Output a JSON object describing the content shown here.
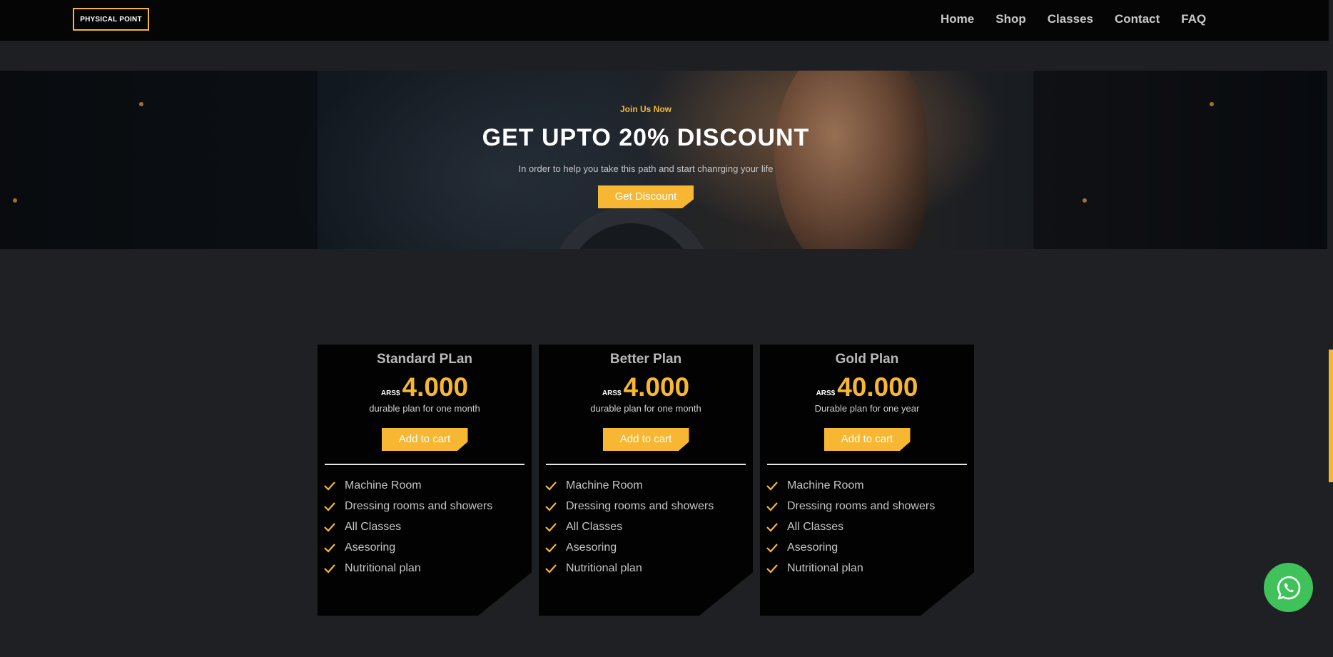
{
  "brand": {
    "logo_text": "PHYSICAL POINT",
    "accent_color": "#f7b733"
  },
  "nav": {
    "links": [
      "Home",
      "Shop",
      "Classes",
      "Contact",
      "FAQ"
    ]
  },
  "hero": {
    "eyebrow": "Join Us Now",
    "title": "GET UPTO 20% DISCOUNT",
    "subtitle": "In order to help you take this path and start chanrging your life",
    "button_label": "Get Discount"
  },
  "plans": [
    {
      "name": "Standard PLan",
      "currency": "ARS$",
      "amount": "4.000",
      "description": "durable plan for one month",
      "button_label": "Add to cart",
      "features": [
        "Machine Room",
        "Dressing rooms and showers",
        "All Classes",
        "Asesoring",
        "Nutritional plan"
      ]
    },
    {
      "name": "Better Plan",
      "currency": "ARS$",
      "amount": "4.000",
      "description": "durable plan for one month",
      "button_label": "Add to cart",
      "features": [
        "Machine Room",
        "Dressing rooms and showers",
        "All Classes",
        "Asesoring",
        "Nutritional plan"
      ]
    },
    {
      "name": "Gold Plan",
      "currency": "ARS$",
      "amount": "40.000",
      "description": "Durable plan for one year",
      "button_label": "Add to cart",
      "features": [
        "Machine Room",
        "Dressing rooms and showers",
        "All Classes",
        "Asesoring",
        "Nutritional plan"
      ]
    }
  ],
  "icons": {
    "feature": "check-icon",
    "chat": "whatsapp-icon"
  },
  "colors": {
    "whatsapp": "#3fc25a"
  }
}
